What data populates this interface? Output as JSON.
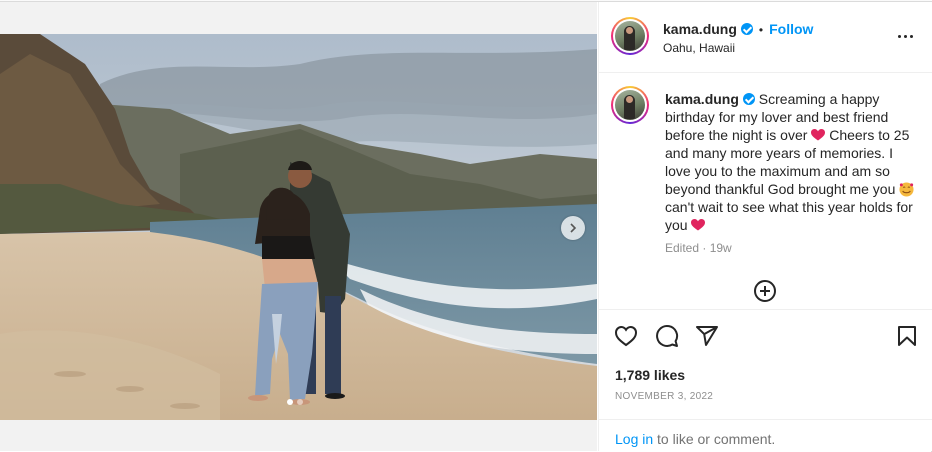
{
  "post": {
    "username": "kama.dung",
    "follow_label": "Follow",
    "separator": "•",
    "location": "Oahu, Hawaii",
    "caption_part1": "Screaming a happy birthday for my lover and best friend before the night is over",
    "caption_part2": "Cheers to 25 and many more years of memories. I love you to the maximum and am so beyond thankful God brought me you",
    "caption_part3": "can't wait to see what this year holds for you",
    "edited": "Edited",
    "time_ago": "19w",
    "likes": "1,789 likes",
    "date": "NOVEMBER 3, 2022",
    "login_link": "Log in",
    "login_suffix": "to like or comment.",
    "carousel_count": 2,
    "carousel_active_index": 0
  },
  "icons": {
    "verified": "verified-badge-icon",
    "more": "more-options-icon",
    "next": "chevron-right-icon",
    "add": "add-circle-icon",
    "like": "heart-icon",
    "comment": "comment-icon",
    "share": "share-icon",
    "save": "bookmark-icon",
    "emoji_heart": "red-heart-emoji",
    "emoji_face": "smiling-face-with-hearts-emoji"
  },
  "colors": {
    "accent": "#0095f6",
    "text": "#262626",
    "muted": "#8e8e8e",
    "heart_emoji": "#e0245e"
  }
}
